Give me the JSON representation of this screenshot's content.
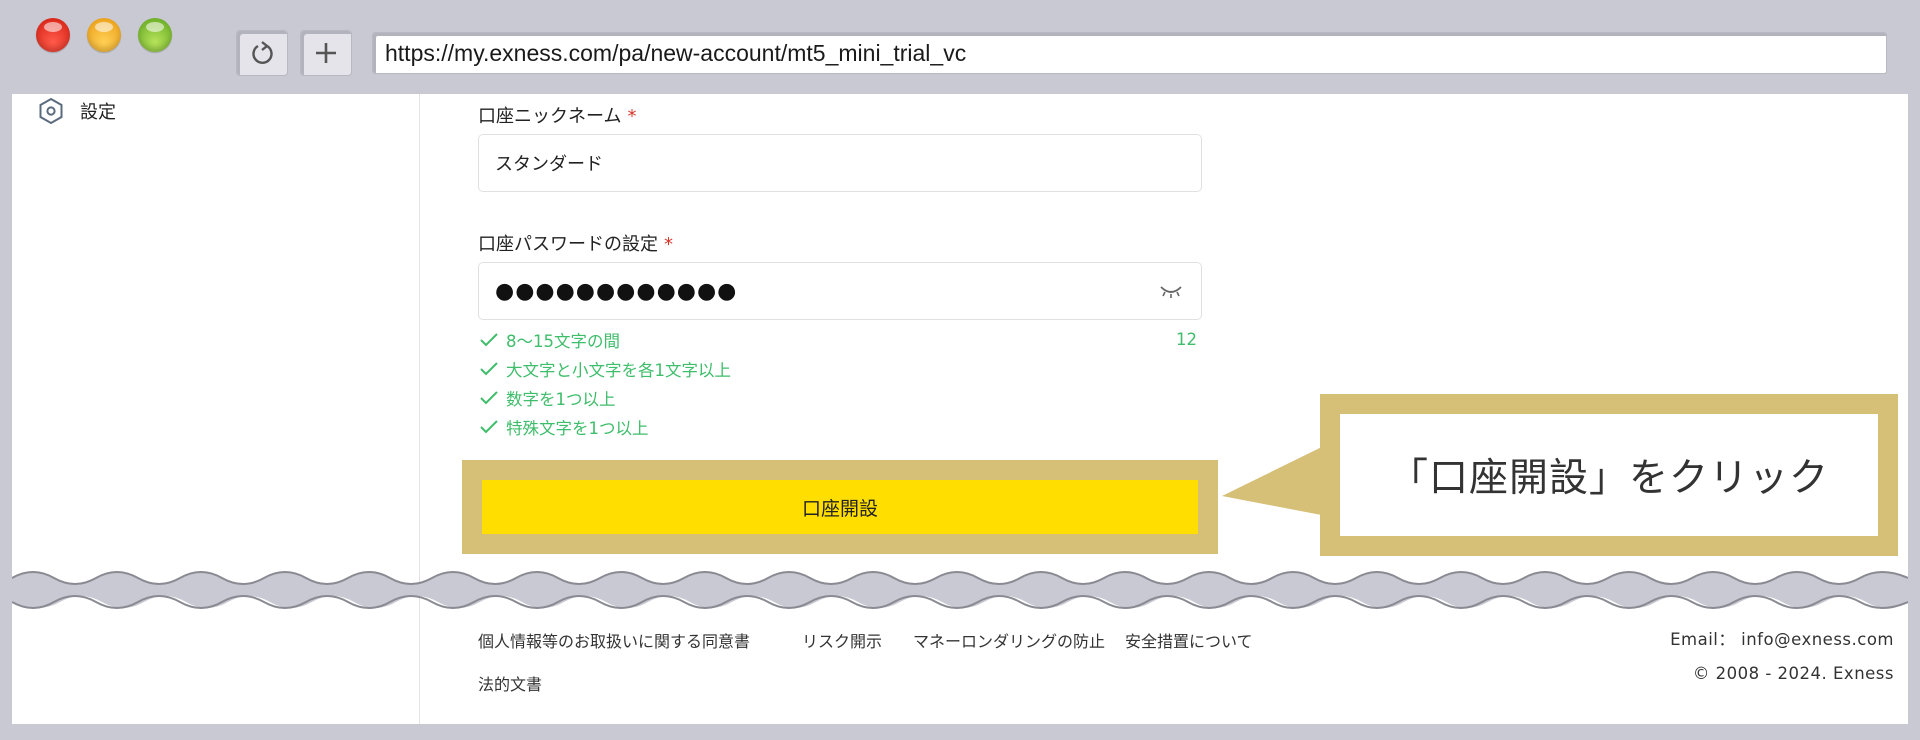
{
  "browser": {
    "url": "https://my.exness.com/pa/new-account/mt5_mini_trial_vc",
    "reload_icon": "reload-icon",
    "new_tab_icon": "plus-icon"
  },
  "sidebar": {
    "items": [
      {
        "label": "設定",
        "icon": "settings-hexagon-icon"
      }
    ]
  },
  "form": {
    "nickname": {
      "label": "口座ニックネーム",
      "required_mark": "*",
      "value": "スタンダード"
    },
    "password": {
      "label": "口座パスワードの設定",
      "required_mark": "*",
      "masked_value": "●●●●●●●●●●●●",
      "length_counter": "12",
      "toggle_icon": "eye-closed-icon",
      "rules": [
        "8～15文字の間",
        "大文字と小文字を各1文字以上",
        "数字を1つ以上",
        "特殊文字を1つ以上"
      ]
    },
    "submit_label": "口座開設"
  },
  "callout": {
    "text": "「口座開設」をクリック"
  },
  "footer": {
    "links": [
      "個人情報等のお取扱いに関する同意書",
      "リスク開示",
      "マネーロンダリングの防止",
      "安全措置について"
    ],
    "legal": "法的文書",
    "email": "Email： info@exness.com",
    "copyright": "© 2008 - 2024. Exness"
  },
  "colors": {
    "accent_button": "#ffde00",
    "callout_frame": "#d6bf76",
    "success_green": "#3ebd6a",
    "required_red": "#d9342b",
    "chrome_gray": "#c9c9d3"
  }
}
